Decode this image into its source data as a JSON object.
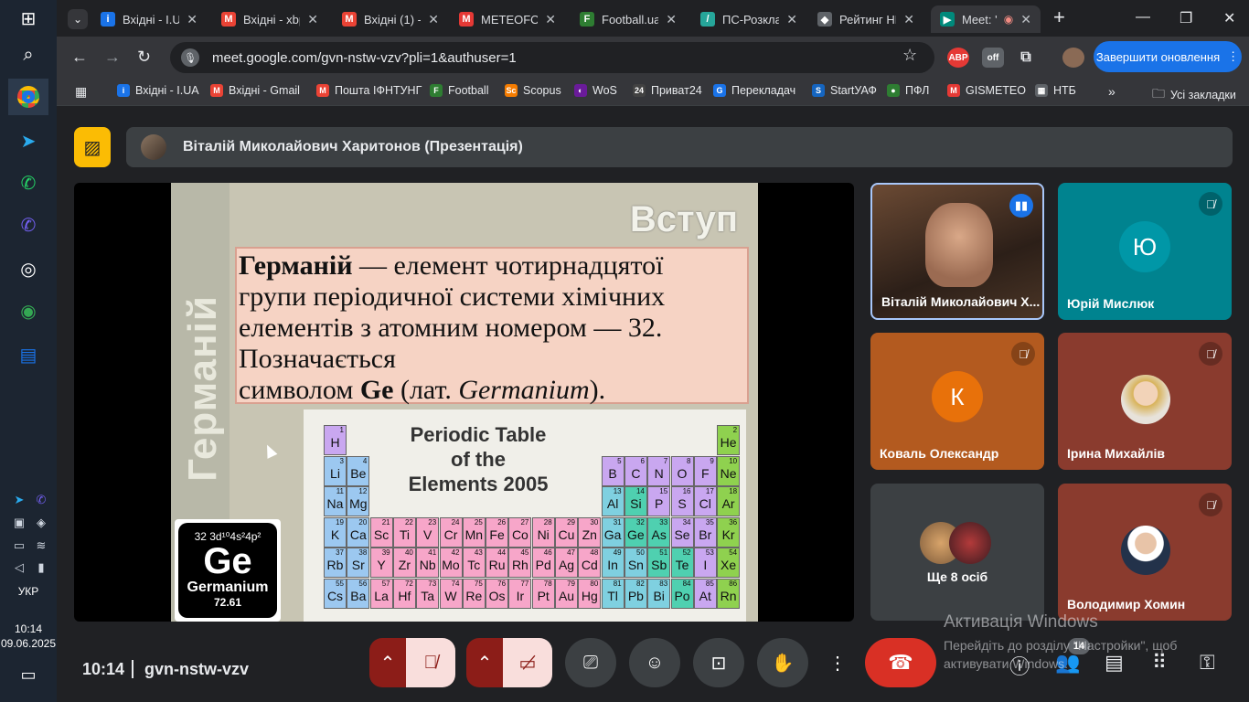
{
  "taskbar": {
    "lang": "УКР",
    "time": "10:14",
    "date": "09.06.2025"
  },
  "tabs": [
    {
      "title": "Вхідні - I.UA",
      "icon": "i-ua-icon",
      "color": "#1a73e8",
      "glyph": "i"
    },
    {
      "title": "Вхідні - xbp",
      "icon": "gmail-icon",
      "color": "#ea4335",
      "glyph": "M"
    },
    {
      "title": "Вхідні (1) -",
      "icon": "gmail-icon",
      "color": "#ea4335",
      "glyph": "M"
    },
    {
      "title": "METEOFOR",
      "icon": "meteofor-icon",
      "color": "#e53935",
      "glyph": "M"
    },
    {
      "title": "Football.ua",
      "icon": "football-icon",
      "color": "#2e7d32",
      "glyph": "F"
    },
    {
      "title": "ПС-Розклад",
      "icon": "ps-icon",
      "color": "#26a69a",
      "glyph": "/"
    },
    {
      "title": "Рейтинг НП",
      "icon": "rating-icon",
      "color": "#5f6368",
      "glyph": "◆"
    },
    {
      "title": "Meet: '",
      "icon": "meet-icon",
      "color": "#00897b",
      "glyph": "▶"
    }
  ],
  "url": "meet.google.com/gvn-nstw-vzv?pli=1&authuser=1",
  "update_button": "Завершити оновлення",
  "bookmarks": [
    {
      "label": "Вхідні - I.UA",
      "color": "#1a73e8",
      "glyph": "i"
    },
    {
      "label": "Вхідні - Gmail",
      "color": "#ea4335",
      "glyph": "M"
    },
    {
      "label": "Пошта ІФНТУНГ",
      "color": "#ea4335",
      "glyph": "M"
    },
    {
      "label": "Football",
      "color": "#2e7d32",
      "glyph": "F"
    },
    {
      "label": "Scopus",
      "color": "#f57c00",
      "glyph": "Sc"
    },
    {
      "label": "WoS",
      "color": "#6a1b9a",
      "glyph": "◐"
    },
    {
      "label": "Приват24",
      "color": "#424242",
      "glyph": "24"
    },
    {
      "label": "Перекладач",
      "color": "#1a73e8",
      "glyph": "G"
    },
    {
      "label": "StartУАФ",
      "color": "#1565c0",
      "glyph": "S"
    },
    {
      "label": "ПФЛ",
      "color": "#2e7d32",
      "glyph": "●"
    },
    {
      "label": "GISMETEO",
      "color": "#e53935",
      "glyph": "M"
    },
    {
      "label": "НТБ",
      "color": "#5f6368",
      "glyph": "▦"
    }
  ],
  "all_bookmarks": "Усі закладки",
  "presenter_title": "Віталій Миколайович Харитонов (Презентація)",
  "slide": {
    "side_title": "Германій",
    "heading": "Вступ",
    "line1_bold": "Германій",
    "line1_rest": " — елемент чотирнадцятої",
    "line2": "групи  періодичної системи хімічних",
    "line3": "елементів з  атомним номером — 32.",
    "line4": "Позначається",
    "line5_pre": "символом ",
    "line5_bold": "Ge",
    "line5_mid": " (лат. ",
    "line5_ital": "Germanium",
    "line5_end": ").",
    "table_title_1": "Periodic Table",
    "table_title_2": "of the",
    "table_title_3": "Elements 2005",
    "card_config": "32   3d¹⁰4s²4p²",
    "card_symbol": "Ge",
    "card_name": "Germanium",
    "card_mass": "72.61"
  },
  "participants": [
    {
      "name": "Віталій Миколайович Х...",
      "type": "video",
      "speaking": true
    },
    {
      "name": "Юрій Мислюк",
      "letter": "Ю",
      "bg": "#00838f",
      "circle": "#0097a7",
      "muted": true
    },
    {
      "name": "Коваль Олександр",
      "letter": "К",
      "bg": "#b35a1f",
      "circle": "#e8710a",
      "muted": true
    },
    {
      "name": "Ірина Михайлів",
      "type": "photo",
      "bg": "#8a3b2e",
      "muted": true
    },
    {
      "name": "Ще 8 осіб",
      "type": "more",
      "bg": "#3c4043"
    },
    {
      "name": "Володимир Хомин",
      "type": "photo",
      "bg": "#8a3b2e",
      "muted": true
    }
  ],
  "bottom": {
    "time": "10:14",
    "meeting_code": "gvn-nstw-vzv",
    "people_count": "14"
  },
  "watermark": {
    "line1": "Активація Windows",
    "line2": "Перейдіть до розділу \"Настройки\", щоб активувати Windows."
  }
}
